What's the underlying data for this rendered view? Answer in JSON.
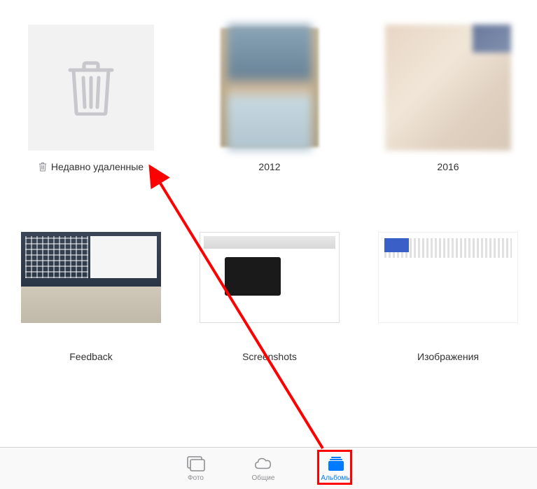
{
  "albums": [
    {
      "id": "recently-deleted",
      "label": "Недавно удаленные",
      "thumb_type": "deleted"
    },
    {
      "id": "album-2012",
      "label": "2012",
      "thumb_type": "2012"
    },
    {
      "id": "album-2016",
      "label": "2016",
      "thumb_type": "2016"
    },
    {
      "id": "album-feedback",
      "label": "Feedback",
      "thumb_type": "feedback"
    },
    {
      "id": "album-screenshots",
      "label": "Screenshots",
      "thumb_type": "screenshots"
    },
    {
      "id": "album-images",
      "label": "Изображения",
      "thumb_type": "images"
    }
  ],
  "tabs": [
    {
      "id": "photos",
      "label": "Фото",
      "active": false
    },
    {
      "id": "shared",
      "label": "Общие",
      "active": false
    },
    {
      "id": "albums",
      "label": "Альбомы",
      "active": true
    }
  ],
  "colors": {
    "accent": "#007aff",
    "inactive": "#8e8e93",
    "annotation": "#ff0000"
  }
}
